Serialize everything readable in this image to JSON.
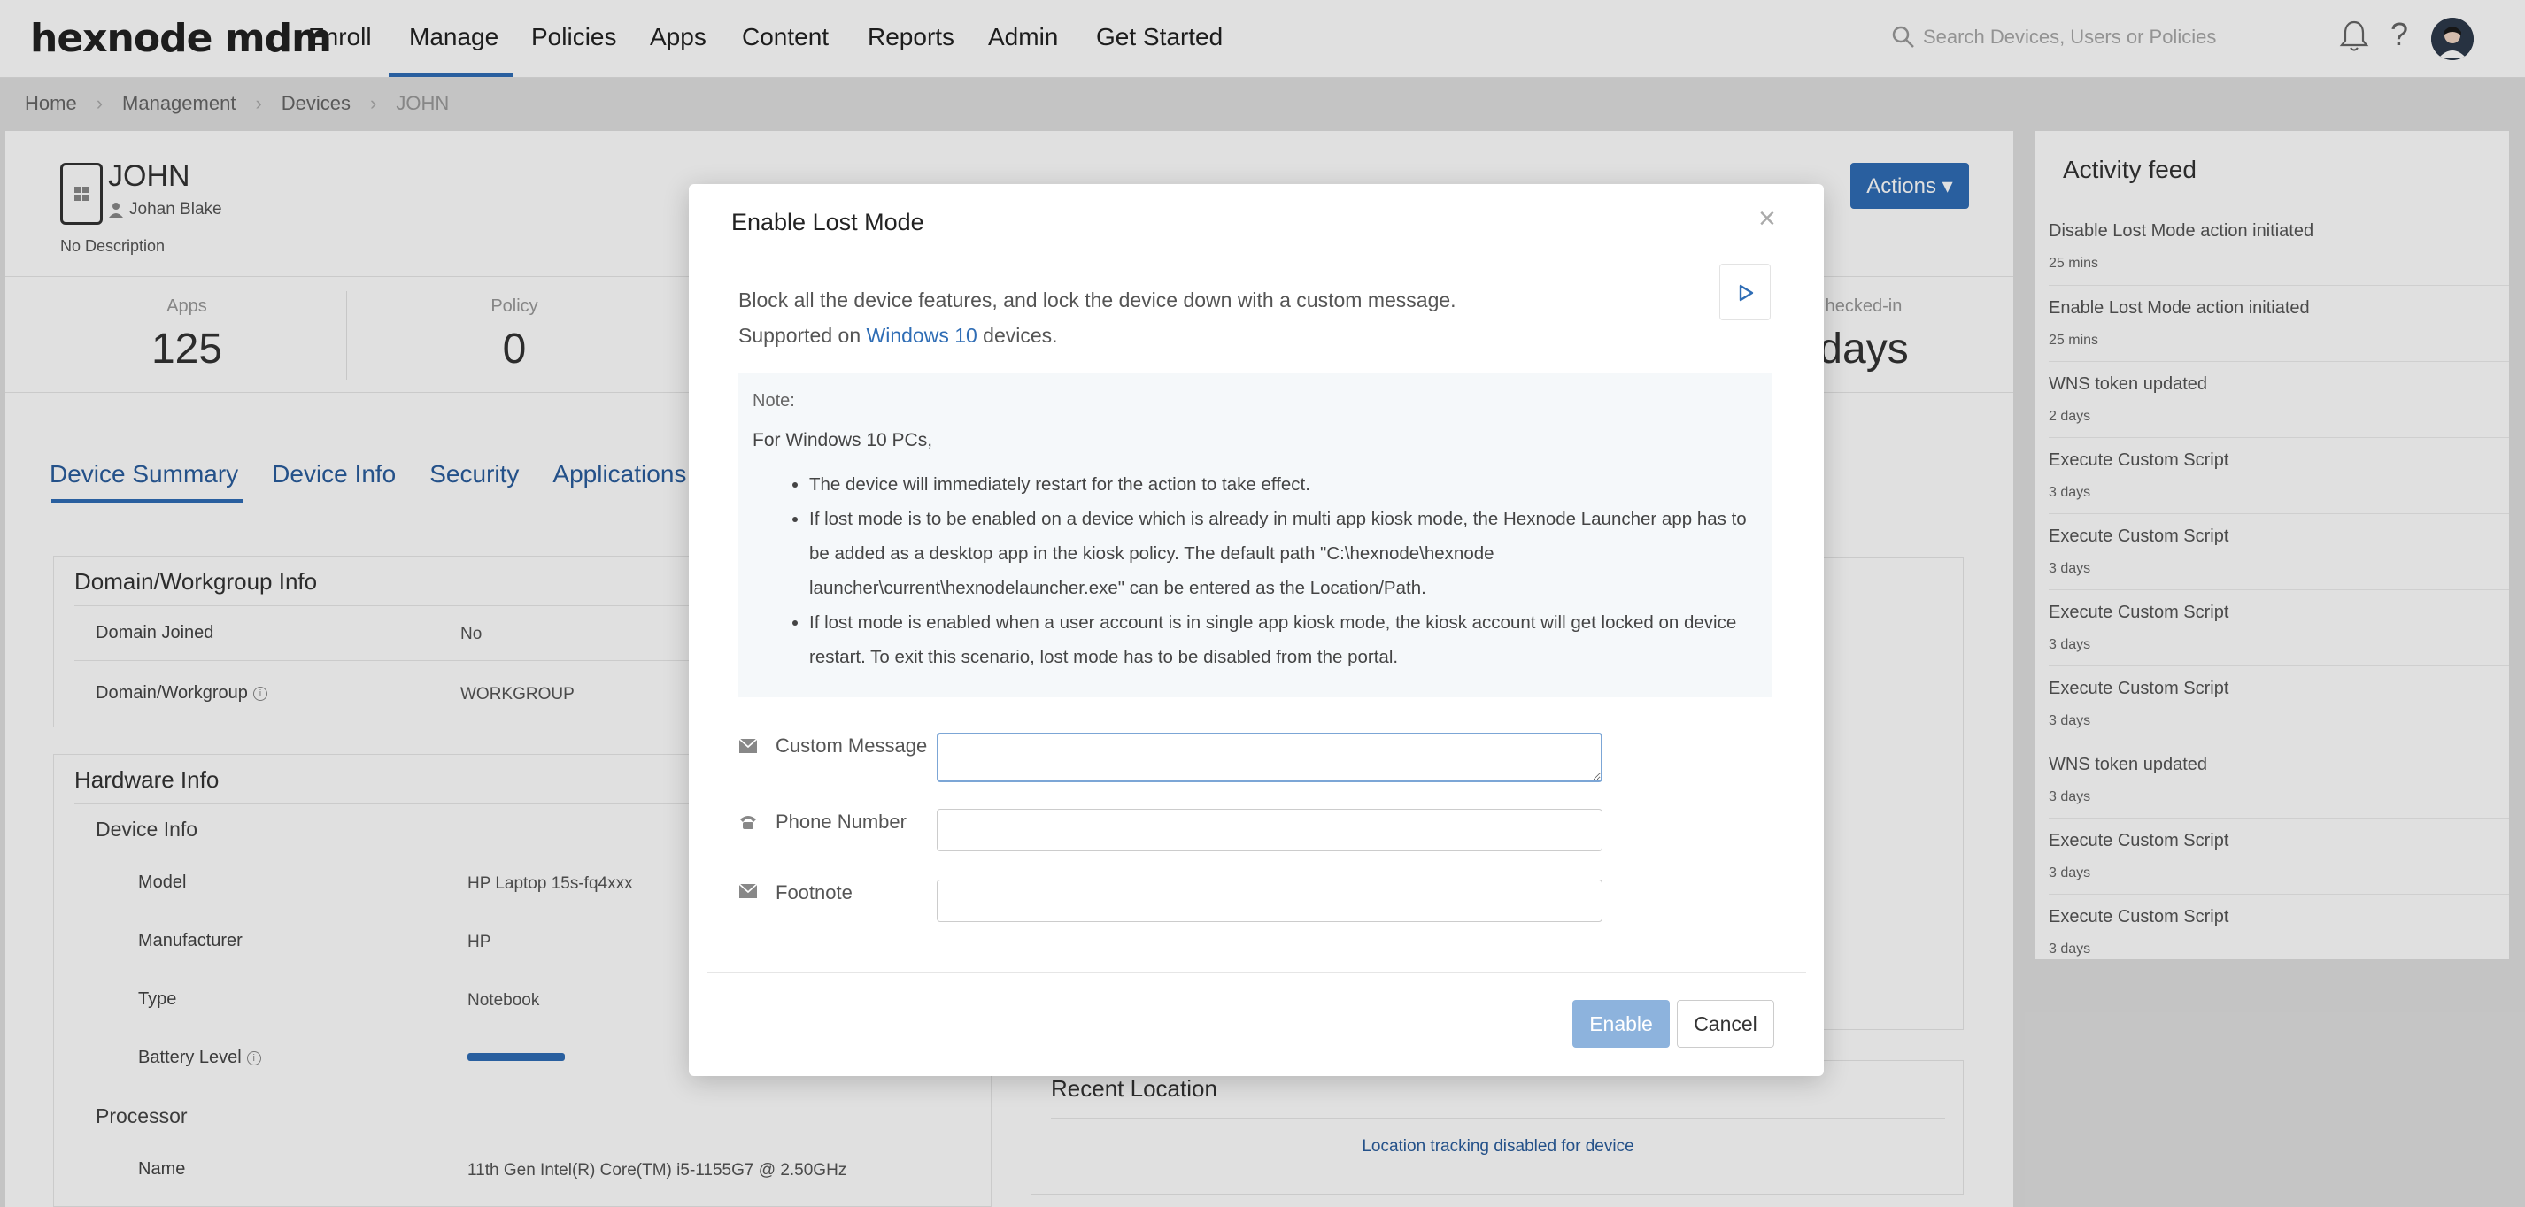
{
  "brand": {
    "logo_text": "hexnode mdm",
    "accent": "#2f6db5"
  },
  "nav": {
    "items": [
      "Enroll",
      "Manage",
      "Policies",
      "Apps",
      "Content",
      "Reports",
      "Admin",
      "Get Started"
    ],
    "active": "Manage",
    "search_placeholder": "Search Devices, Users or Policies",
    "help_glyph": "?"
  },
  "breadcrumb": [
    "Home",
    "Management",
    "Devices",
    "JOHN"
  ],
  "device": {
    "name": "JOHN",
    "owner": "Johan Blake",
    "description": "No Description",
    "actions_label": "Actions ▾"
  },
  "stats": [
    {
      "label": "Apps",
      "value": "125"
    },
    {
      "label": "Policy",
      "value": "0"
    },
    {
      "label": "hecked-in",
      "value": "days"
    }
  ],
  "tabs": [
    "Device Summary",
    "Device Info",
    "Security",
    "Applications"
  ],
  "domain_card": {
    "title": "Domain/Workgroup Info",
    "rows": [
      {
        "label": "Domain Joined",
        "value": "No"
      },
      {
        "label": "Domain/Workgroup",
        "value": "WORKGROUP"
      }
    ]
  },
  "hardware_card": {
    "title": "Hardware Info",
    "device_info_heading": "Device Info",
    "rows": [
      {
        "label": "Model",
        "value": "HP Laptop 15s-fq4xxx"
      },
      {
        "label": "Manufacturer",
        "value": "HP"
      },
      {
        "label": "Type",
        "value": "Notebook"
      },
      {
        "label": "Battery Level",
        "value": ""
      }
    ],
    "battery_level_fraction": 0.25,
    "processor_heading": "Processor",
    "processor_rows": [
      {
        "label": "Name",
        "value": "11th Gen Intel(R) Core(TM) i5-1155G7 @ 2.50GHz"
      }
    ]
  },
  "recent_location": {
    "title": "Recent Location",
    "message": "Location tracking disabled for device"
  },
  "activity_feed": {
    "title": "Activity feed",
    "items": [
      {
        "text": "Disable Lost Mode action initiated",
        "time": "25 mins"
      },
      {
        "text": "Enable Lost Mode action initiated",
        "time": "25 mins"
      },
      {
        "text": "WNS token updated",
        "time": "2 days"
      },
      {
        "text": "Execute Custom Script",
        "time": "3 days"
      },
      {
        "text": "Execute Custom Script",
        "time": "3 days"
      },
      {
        "text": "Execute Custom Script",
        "time": "3 days"
      },
      {
        "text": "Execute Custom Script",
        "time": "3 days"
      },
      {
        "text": "WNS token updated",
        "time": "3 days"
      },
      {
        "text": "Execute Custom Script",
        "time": "3 days"
      },
      {
        "text": "Execute Custom Script",
        "time": "3 days"
      }
    ]
  },
  "modal": {
    "title": "Enable Lost Mode",
    "close_glyph": "×",
    "desc_line1": "Block all the device features, and lock the device down with a custom message.",
    "desc_line2_prefix": "Supported on ",
    "desc_line2_link": "Windows 10",
    "desc_line2_suffix": " devices.",
    "note_label": "Note:",
    "note_intro": "For Windows 10 PCs,",
    "note_items": [
      "The device will immediately restart for the action to take effect.",
      "If lost mode is to be enabled on a device which is already in multi app kiosk mode, the Hexnode Launcher app has to be added as a desktop app in the kiosk policy. The default path \"C:\\hexnode\\hexnode launcher\\current\\hexnodelauncher.exe\" can be entered as the Location/Path.",
      "If lost mode is enabled when a user account is in single app kiosk mode, the kiosk account will get locked on device restart. To exit this scenario, lost mode has to be disabled from the portal."
    ],
    "fields": {
      "custom_message": {
        "label": "Custom Message",
        "value": "",
        "icon": "envelope-icon"
      },
      "phone_number": {
        "label": "Phone Number",
        "value": "",
        "icon": "phone-icon"
      },
      "footnote": {
        "label": "Footnote",
        "value": "",
        "icon": "envelope-icon"
      }
    },
    "enable_label": "Enable",
    "cancel_label": "Cancel"
  }
}
